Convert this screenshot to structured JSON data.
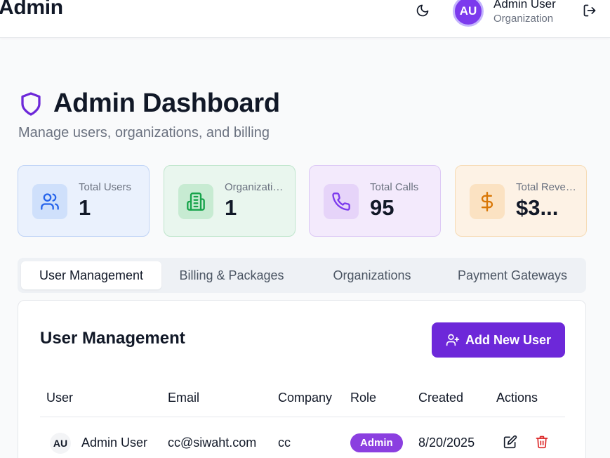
{
  "header": {
    "brand": "Admin",
    "avatar_initials": "AU",
    "user_name": "Admin User",
    "user_org": "Organization",
    "icons": [
      "moon-icon",
      "logout-icon"
    ]
  },
  "page": {
    "title": "Admin Dashboard",
    "subtitle": "Manage users, organizations, and billing"
  },
  "stats": [
    {
      "label": "Total Users",
      "value": "1",
      "icon": "users-icon",
      "color": "#2563eb"
    },
    {
      "label": "Organizations",
      "value": "1",
      "icon": "building-icon",
      "color": "#16a34a"
    },
    {
      "label": "Total Calls",
      "value": "95",
      "icon": "phone-icon",
      "color": "#7c3aed"
    },
    {
      "label": "Total Revenue",
      "value": "$3...",
      "icon": "dollar-icon",
      "color": "#d97706"
    }
  ],
  "tabs": [
    {
      "label": "User Management",
      "active": true
    },
    {
      "label": "Billing & Packages",
      "active": false
    },
    {
      "label": "Organizations",
      "active": false
    },
    {
      "label": "Payment Gateways",
      "active": false
    }
  ],
  "user_panel": {
    "title": "User Management",
    "add_button": "Add New User",
    "columns": [
      "User",
      "Email",
      "Company",
      "Role",
      "Created",
      "Actions"
    ],
    "rows": [
      {
        "initials": "AU",
        "name": "Admin User",
        "email": "cc@siwaht.com",
        "company": "cc",
        "role": "Admin",
        "created": "8/20/2025"
      }
    ]
  },
  "colors": {
    "accent": "#6d28d9",
    "badge": "#8b3fe0",
    "danger": "#dc2626"
  }
}
